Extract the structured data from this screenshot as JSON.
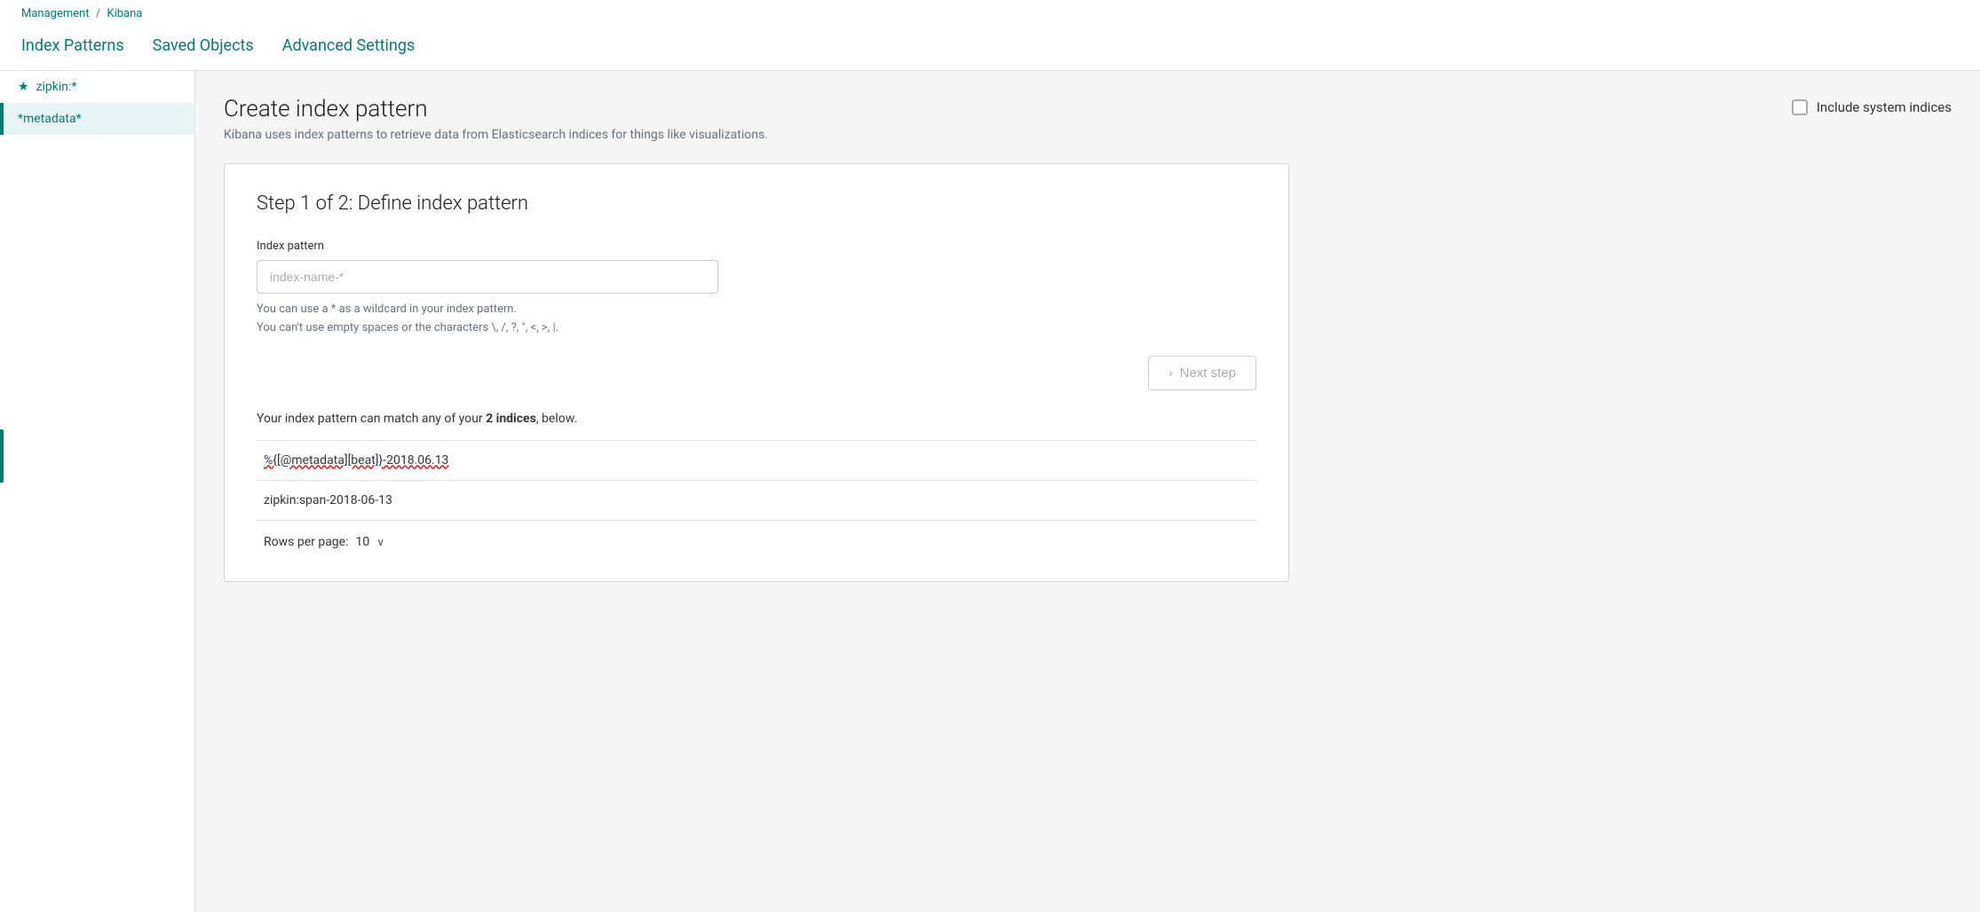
{
  "breadcrumb": {
    "management": "Management",
    "separator": "/",
    "kibana": "Kibana"
  },
  "tabs": [
    {
      "id": "index-patterns",
      "label": "Index Patterns"
    },
    {
      "id": "saved-objects",
      "label": "Saved Objects"
    },
    {
      "id": "advanced-settings",
      "label": "Advanced Settings"
    }
  ],
  "sidebar": {
    "items": [
      {
        "id": "zipkin",
        "label": "zipkin:*",
        "hasStar": true
      },
      {
        "id": "metadata",
        "label": "*metadata*",
        "hasStar": false
      }
    ]
  },
  "page": {
    "title": "Create index pattern",
    "subtitle": "Kibana uses index patterns to retrieve data from Elasticsearch indices for things like visualizations.",
    "system_indices_label": "Include system indices",
    "step_title": "Step 1 of 2: Define index pattern",
    "form": {
      "index_pattern_label": "Index pattern",
      "index_pattern_placeholder": "index-name-*",
      "hint_line1": "You can use a * as a wildcard in your index pattern.",
      "hint_line2": "You can't use empty spaces or the characters \\, /, ?, \", <, >, |."
    },
    "next_step_button": "Next step",
    "match_text_prefix": "Your index pattern can match any of your ",
    "match_count": "2 indices",
    "match_text_suffix": ", below.",
    "indices": [
      {
        "id": "idx1",
        "name": "%{[@metadata][beat]}-2018.06.13",
        "has_error": true
      },
      {
        "id": "idx2",
        "name": "zipkin:span-2018-06-13",
        "has_error": false
      }
    ],
    "rows_per_page_label": "Rows per page:",
    "rows_per_page_value": "10"
  }
}
